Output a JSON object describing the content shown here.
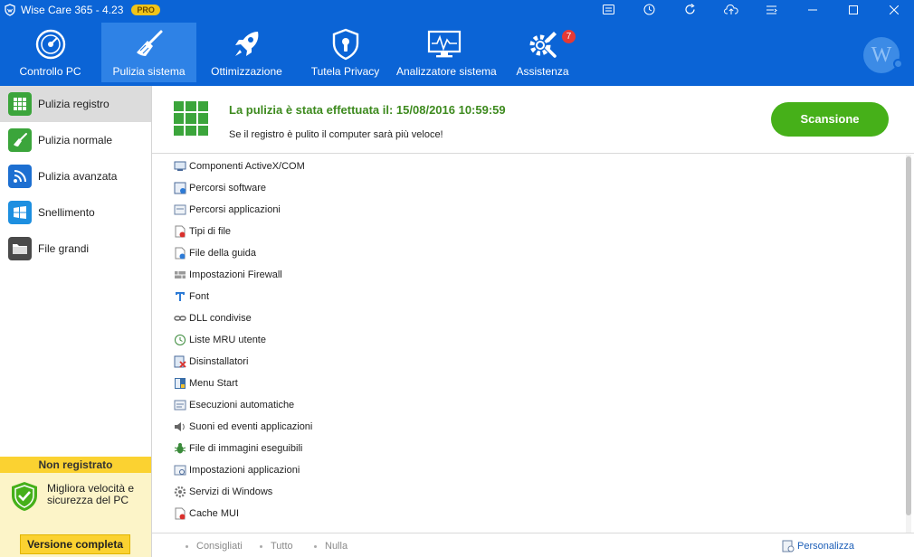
{
  "window": {
    "title": "Wise Care 365 - 4.23",
    "badge": "PRO"
  },
  "nav": {
    "items": [
      {
        "label": "Controllo PC",
        "icon": "gauge-icon"
      },
      {
        "label": "Pulizia sistema",
        "icon": "broom-icon",
        "active": true
      },
      {
        "label": "Ottimizzazione",
        "icon": "rocket-icon"
      },
      {
        "label": "Tutela Privacy",
        "icon": "shield-icon"
      },
      {
        "label": "Analizzatore sistema",
        "icon": "monitor-icon"
      },
      {
        "label": "Assistenza",
        "icon": "tools-icon",
        "badge": "7"
      }
    ],
    "avatar_letter": "W"
  },
  "sidebar": {
    "items": [
      {
        "label": "Pulizia registro",
        "icon": "registry-icon",
        "color": "#3ba53b",
        "active": true
      },
      {
        "label": "Pulizia normale",
        "icon": "broom-icon",
        "color": "#3ba53b"
      },
      {
        "label": "Pulizia avanzata",
        "icon": "wave-icon",
        "color": "#1d6fd1"
      },
      {
        "label": "Snellimento",
        "icon": "windows-icon",
        "color": "#1d8fe0"
      },
      {
        "label": "File grandi",
        "icon": "folder-icon",
        "color": "#4a4a4a"
      }
    ],
    "promo": {
      "header": "Non registrato",
      "text_line1": "Migliora velocità e",
      "text_line2": "sicurezza del PC",
      "button": "Versione completa"
    }
  },
  "header": {
    "title": "La pulizia è stata effettuata il: 15/08/2016 10:59:59",
    "subtitle": "Se il registro è pulito il computer sarà più veloce!",
    "scan_button": "Scansione"
  },
  "registry_items": [
    {
      "label": "Componenti ActiveX/COM",
      "icon": "activex-icon"
    },
    {
      "label": "Percorsi software",
      "icon": "software-path-icon"
    },
    {
      "label": "Percorsi applicazioni",
      "icon": "app-path-icon"
    },
    {
      "label": "Tipi di file",
      "icon": "file-type-icon"
    },
    {
      "label": "File della guida",
      "icon": "help-file-icon"
    },
    {
      "label": "Impostazioni Firewall",
      "icon": "firewall-icon"
    },
    {
      "label": "Font",
      "icon": "font-icon"
    },
    {
      "label": "DLL condivise",
      "icon": "dll-icon"
    },
    {
      "label": "Liste MRU utente",
      "icon": "mru-icon"
    },
    {
      "label": "Disinstallatori",
      "icon": "uninstall-icon"
    },
    {
      "label": "Menu Start",
      "icon": "start-menu-icon"
    },
    {
      "label": "Esecuzioni automatiche",
      "icon": "autorun-icon"
    },
    {
      "label": "Suoni ed eventi applicazioni",
      "icon": "sound-icon"
    },
    {
      "label": "File di immagini eseguibili",
      "icon": "bug-icon"
    },
    {
      "label": "Impostazioni applicazioni",
      "icon": "app-settings-icon"
    },
    {
      "label": "Servizi di Windows",
      "icon": "gear-icon"
    },
    {
      "label": "Cache MUI",
      "icon": "mui-cache-icon"
    }
  ],
  "footer": {
    "filters": [
      "Consigliati",
      "Tutto",
      "Nulla"
    ],
    "customize": "Personalizza"
  }
}
